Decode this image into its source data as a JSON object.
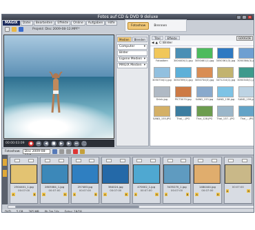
{
  "window": {
    "title": "Fotos auf CD & DVD 9 deluxe"
  },
  "menu": {
    "logo": "MAGIX",
    "items": [
      "Datei",
      "Bearbeiten",
      "Effekte",
      "Online",
      "Aufgaben",
      "Hilfe"
    ]
  },
  "project": {
    "label": "Projekt: Disc 2009-08-12.MPF*"
  },
  "mode_tabs": [
    "Fotoshow",
    "Brennen"
  ],
  "transport": {
    "time": "00:00:03:09"
  },
  "side": {
    "tabs": [
      "Medien",
      "Blenden",
      "Titel",
      "Effekte"
    ],
    "items": [
      "Computer",
      "Bilder",
      "Eigene Medien",
      "MAGIX Medien"
    ]
  },
  "browser": {
    "close_label": "GOOGOE",
    "path": "C:\\Bilder",
    "files": [
      "Fotoalben",
      "3004404(1).jpg",
      "3050461(1).jpg",
      "3050361(3).jpg",
      "3050384(3).jpg",
      "3050734(1).jpg",
      "3050789(1).jpg",
      "3050734(3).jpg",
      "3471214(1).jpg",
      "3050343(1).jpg",
      "Drink.jpg",
      "PICT0070.jpg",
      "SAND_153.jpg",
      "SAND_138.jpg",
      "SAND_159.jpg",
      "SAND_155.JPG",
      "Thai_...JPG",
      "Thai_128.JPG",
      "Thai_137...JPG",
      "Thai_...JPG"
    ]
  },
  "bottombar": {
    "label": "Fotoshow:",
    "disc": "Disc 2009-08-12 *"
  },
  "clips": [
    {
      "name": "2304401_1.jpg",
      "time": "00:07:00"
    },
    {
      "name": "2803084_1.jpg",
      "time": "00:07:00"
    },
    {
      "name": "257483.jpg",
      "time": "00:07:00"
    },
    {
      "name": "384024.jpg",
      "time": "00:07:00"
    },
    {
      "name": "470002_1.jpg",
      "time": "00:07:00"
    },
    {
      "name": "3435270_1.jpg",
      "time": "00:07:00"
    },
    {
      "name": "1484444.jpg",
      "time": "00:07:00"
    },
    {
      "name": "",
      "time": "00:07:00"
    }
  ],
  "status": {
    "items": [
      "DVD",
      "5 GB",
      "285 MB",
      "0h 2m 14s",
      "Fotos: 18/18"
    ]
  }
}
